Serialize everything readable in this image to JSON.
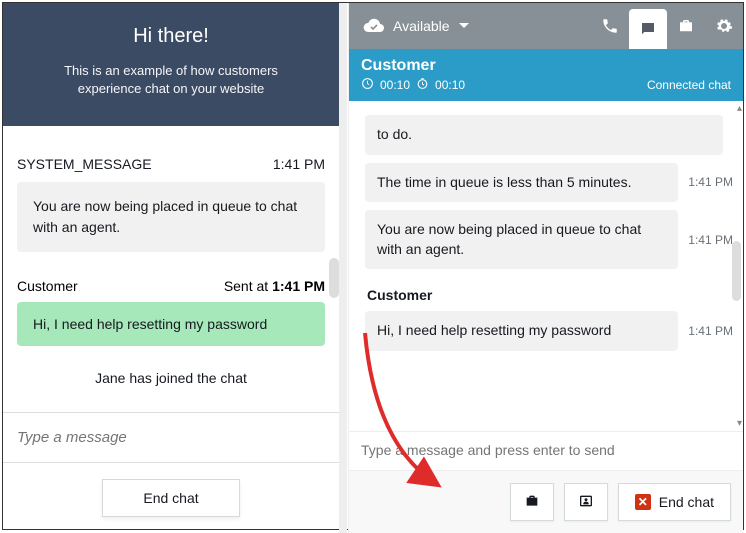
{
  "left": {
    "header": {
      "title": "Hi there!",
      "subtitle": "This is an example of how customers experience chat on your website"
    },
    "system": {
      "label": "SYSTEM_MESSAGE",
      "time": "1:41 PM",
      "text": "You are now being placed in queue to chat with an agent."
    },
    "customer": {
      "label": "Customer",
      "sent_prefix": "Sent at ",
      "time": "1:41 PM",
      "text": "Hi, I need help resetting my password"
    },
    "joined": "Jane has joined the chat",
    "input_placeholder": "Type a message",
    "end_label": "End chat"
  },
  "right": {
    "topbar": {
      "status": "Available"
    },
    "header": {
      "title": "Customer",
      "t1": "00:10",
      "t2": "00:10",
      "status": "Connected chat"
    },
    "messages": [
      {
        "text": "to do.",
        "time": ""
      },
      {
        "text": "The time in queue is less than 5 minutes.",
        "time": "1:41 PM"
      },
      {
        "text": "You are now being placed in queue to chat with an agent.",
        "time": "1:41 PM"
      }
    ],
    "customer_label": "Customer",
    "customer_msg": {
      "text": "Hi, I need help resetting my password",
      "time": "1:41 PM"
    },
    "input_placeholder": "Type a message and press enter to send",
    "end_label": "End chat"
  }
}
